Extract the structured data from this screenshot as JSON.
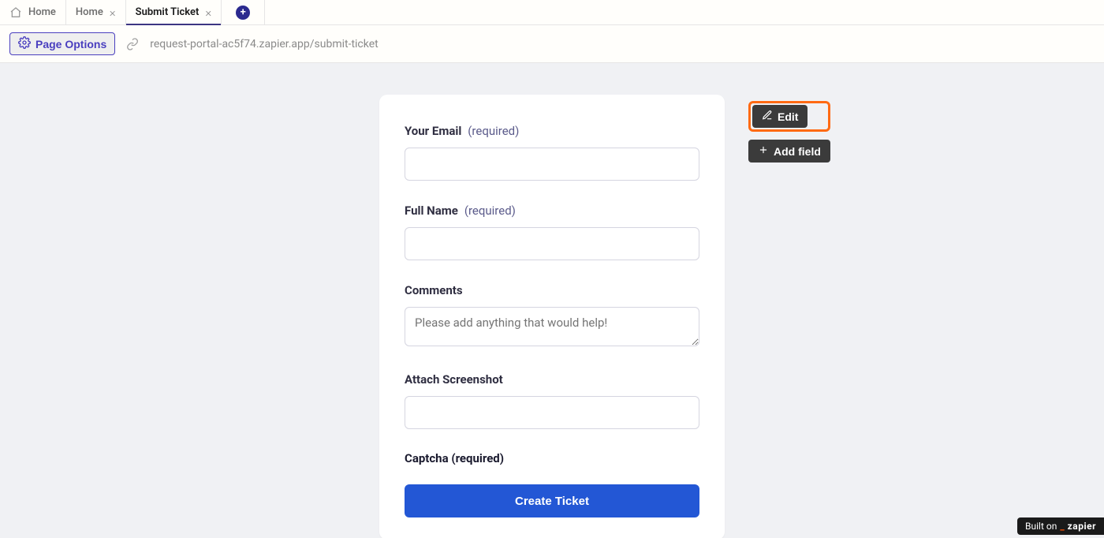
{
  "tabs": {
    "home": "Home",
    "items": [
      {
        "label": "Home",
        "active": false
      },
      {
        "label": "Submit Ticket",
        "active": true
      }
    ]
  },
  "toolbar": {
    "page_options": "Page Options",
    "url": "request-portal-ac5f74.zapier.app/submit-ticket"
  },
  "form": {
    "fields": {
      "email": {
        "label": "Your Email",
        "required_text": "(required)"
      },
      "name": {
        "label": "Full Name",
        "required_text": "(required)"
      },
      "comments": {
        "label": "Comments",
        "placeholder": "Please add anything that would help!"
      },
      "screenshot": {
        "label": "Attach Screenshot"
      },
      "captcha": {
        "label": "Captcha (required)"
      }
    },
    "submit_label": "Create Ticket"
  },
  "side": {
    "edit": "Edit",
    "add_field": "Add field"
  },
  "footer": {
    "built_on": "Built on",
    "brand": "zapier"
  }
}
